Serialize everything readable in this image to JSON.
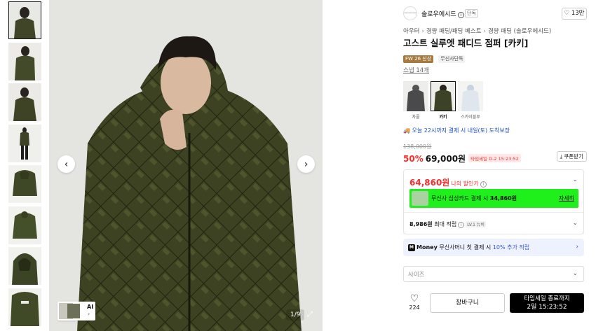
{
  "thumbnails": [
    {
      "label": "thumb-1",
      "selected": true
    },
    {
      "label": "thumb-2",
      "selected": false
    },
    {
      "label": "thumb-3",
      "selected": false
    },
    {
      "label": "thumb-4",
      "selected": false
    },
    {
      "label": "thumb-5",
      "selected": false
    },
    {
      "label": "thumb-6",
      "selected": false
    },
    {
      "label": "thumb-7",
      "selected": false
    },
    {
      "label": "thumb-8",
      "selected": false
    }
  ],
  "gallery": {
    "prev_icon": "‹",
    "next_icon": "›",
    "pager": "1/9",
    "expand_icon": "⤢",
    "ai_label": "AI",
    "ai_arrow": "›"
  },
  "brand": {
    "logo_text": "———",
    "name": "솔로우에시드",
    "info_icon": "i",
    "tag": "단독",
    "like_icon": "♡",
    "like_count": "13만"
  },
  "breadcrumb": [
    "아우터",
    "경량 패딩/패딩 베스트",
    "경량 패딩 (솔로우에시드)"
  ],
  "breadcrumb_sep": "›",
  "product": {
    "title": "고스트 실루엣 패디드 점퍼 [카키]",
    "badges": [
      "FW 26 신상",
      "무신사단독"
    ],
    "snap_link": "스냅 14개"
  },
  "options": [
    {
      "label": "차콜",
      "selected": false,
      "color": "#4a4a4c"
    },
    {
      "label": "카키",
      "selected": true,
      "color": "#3b4225"
    },
    {
      "label": "스카이블루",
      "selected": false,
      "color": "#c7d3e1"
    }
  ],
  "delivery": {
    "icon": "🚚",
    "text": "오늘 22시까지 결제 시 내일(토) 도착보장"
  },
  "pricing": {
    "original": "138,000원",
    "discount": "50%",
    "price": "69,000원",
    "timesale_badge": "타임세일 D-2 15:23:52",
    "coupon_button": "⤓ 쿠폰받기"
  },
  "my_price": {
    "amount": "64,860원",
    "label": "나의 할인가",
    "info_icon": "i",
    "chevron": "⌄"
  },
  "card_promo": {
    "text_prefix": "무신사 삼성카드 결제 시",
    "amount": "34,860원",
    "detail_link": "자세히"
  },
  "points": {
    "amount": "8,986원",
    "text": "최대 적립",
    "info_icon": "i",
    "level": "LV.1 뉴비",
    "chevron": "⌄"
  },
  "money": {
    "logo": "M",
    "brand": "Money",
    "text": "무신사머니 첫 결제 시",
    "highlight": "10% 추가 적립",
    "chevron": "›"
  },
  "size_select": {
    "placeholder": "사이즈",
    "chevron": "⌄"
  },
  "actions": {
    "heart_icon": "♡",
    "heart_count": "224",
    "cart_label": "장바구니",
    "buy_line1": "타임세일 종료까지",
    "buy_line2": "2일 15:23:52"
  },
  "colors": {
    "discount_red": "#ff2b2b",
    "promo_green": "#1fef1b",
    "money_blue": "#3455db",
    "delivery_blue": "#1d4ed8"
  }
}
